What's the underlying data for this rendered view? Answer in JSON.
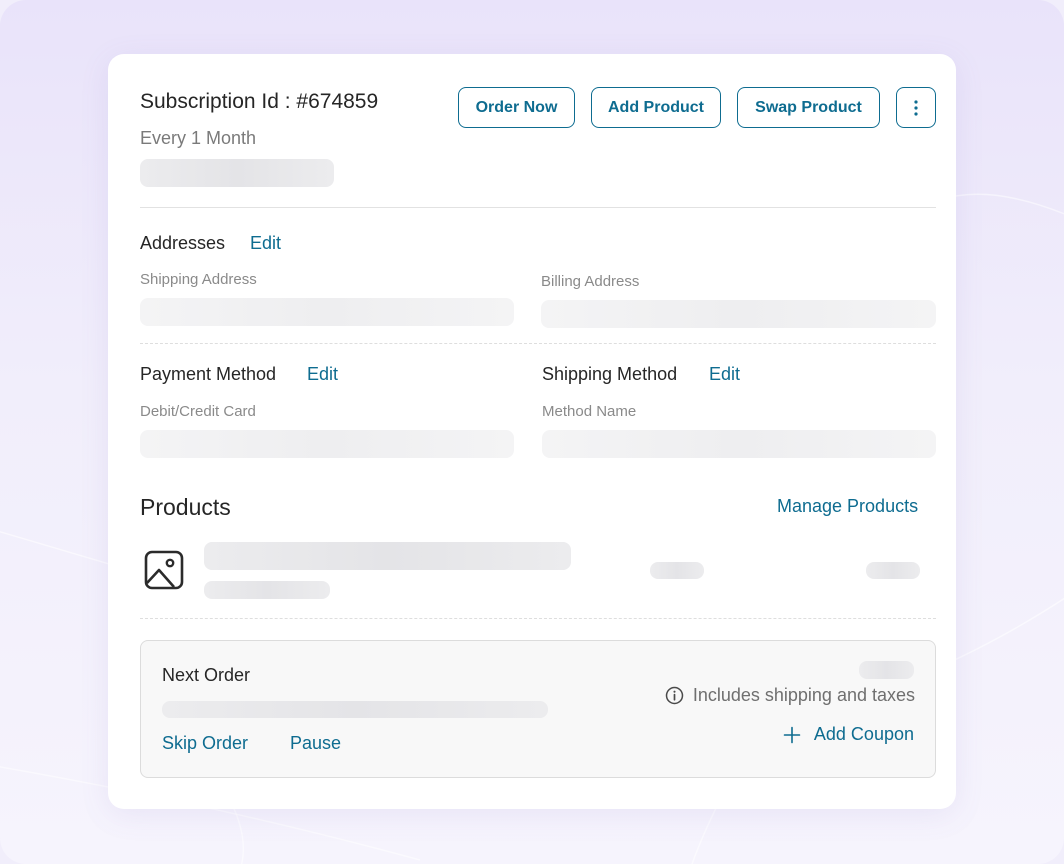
{
  "subscription": {
    "title": "Subscription Id : #674859",
    "frequency": "Every 1 Month"
  },
  "actions": {
    "order_now": "Order Now",
    "add_product": "Add Product",
    "swap_product": "Swap Product",
    "more_icon": "more-vertical-icon"
  },
  "addresses": {
    "heading": "Addresses",
    "edit": "Edit",
    "shipping_label": "Shipping Address",
    "billing_label": "Billing Address"
  },
  "payment": {
    "heading": "Payment Method",
    "edit": "Edit",
    "label": "Debit/Credit Card"
  },
  "shipping_method": {
    "heading": "Shipping Method",
    "edit": "Edit",
    "label": "Method Name"
  },
  "products": {
    "heading": "Products",
    "manage": "Manage Products",
    "image_icon": "image-placeholder-icon"
  },
  "next_order": {
    "heading": "Next Order",
    "skip": "Skip Order",
    "pause": "Pause",
    "includes": "Includes shipping and taxes",
    "info_icon": "info-icon",
    "add_coupon": "Add Coupon",
    "plus_icon": "plus-icon"
  },
  "colors": {
    "accent": "#0e6c90",
    "background": "#f1eefb",
    "card": "#ffffff"
  }
}
